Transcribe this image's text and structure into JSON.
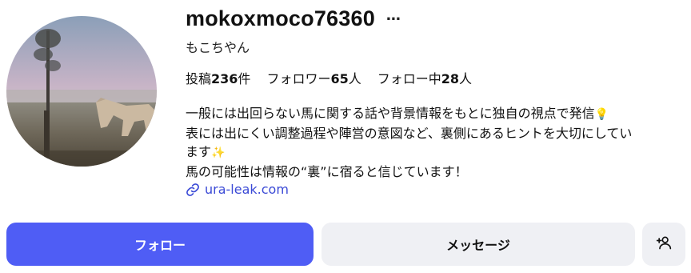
{
  "profile": {
    "username": "mokoxmoco76360",
    "more_icon": "…",
    "display_name": "もこちやん",
    "stats": {
      "posts_label": "投稿",
      "posts_count": "236",
      "posts_unit": "件",
      "followers_label": "フォロワー",
      "followers_count": "65",
      "followers_unit": "人",
      "following_label": "フォロー中",
      "following_count": "28",
      "following_unit": "人"
    },
    "bio": {
      "line1": "一般には出回らない馬に関する話や背景情報をもとに独自の視点で発信",
      "line1_emoji": "💡",
      "line2": "表には出にくい調整過程や陣営の意図など、裏側にあるヒントを大切にしてい",
      "line3": "ます",
      "line3_emoji": "✨",
      "line4": "馬の可能性は情報の“裏”に宿ると信じています！"
    },
    "link": {
      "text": "ura-leak.com",
      "icon": "link-icon"
    }
  },
  "actions": {
    "follow_label": "フォロー",
    "message_label": "メッセージ",
    "add_user_icon": "add-user-icon"
  },
  "colors": {
    "primary": "#4f5df5",
    "secondary_button": "#eff0f4",
    "link": "#3b4ad6",
    "text": "#111111"
  }
}
